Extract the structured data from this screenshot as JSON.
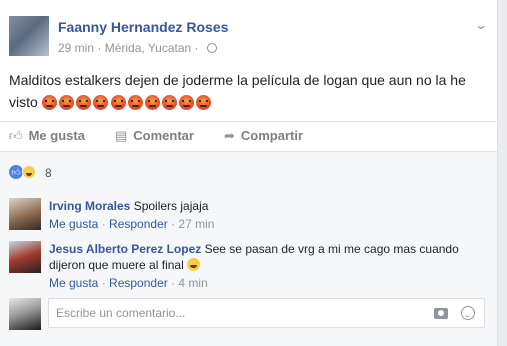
{
  "post": {
    "author": "Faanny Hernandez Roses",
    "time": "29 min",
    "location": "Mérida, Yucatan",
    "text": "Malditos estalkers dejen de joderme la película de logan que aun no la he visto",
    "emoji_count": 10
  },
  "actions": {
    "like": "Me gusta",
    "comment": "Comentar",
    "share": "Compartir"
  },
  "reactions": {
    "count": "8"
  },
  "comments": [
    {
      "name": "Irving Morales",
      "text": "Spoilers jajaja",
      "like": "Me gusta",
      "reply": "Responder",
      "time": "27 min"
    },
    {
      "name": "Jesus Alberto Perez Lopez",
      "text": "See se pasan de vrg a mi me cago mas cuando dijeron que muere al final",
      "like": "Me gusta",
      "reply": "Responder",
      "time": "4 min"
    }
  ],
  "composer": {
    "placeholder": "Escribe un comentario..."
  },
  "separator": " · "
}
